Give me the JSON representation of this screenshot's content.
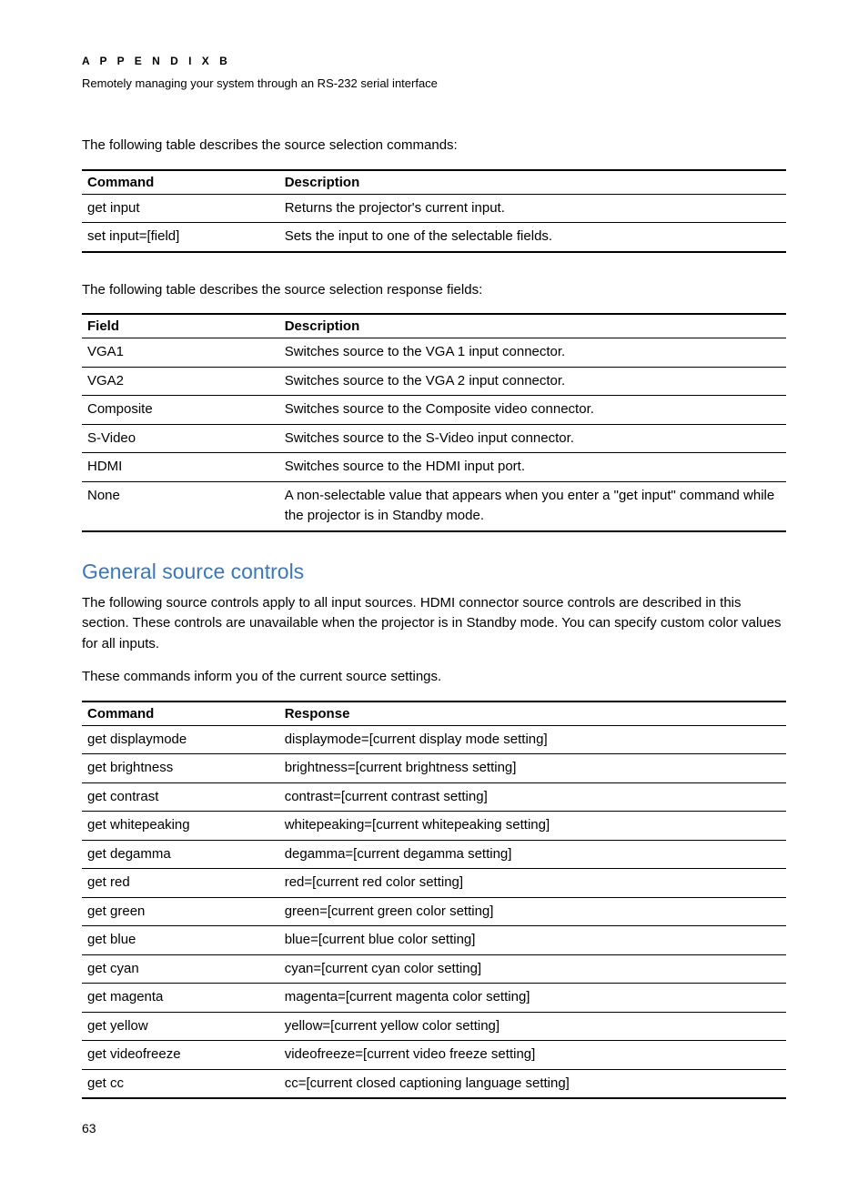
{
  "header": {
    "appendix": "A P P E N D I X   B",
    "subtitle": "Remotely managing your system through an RS-232 serial interface"
  },
  "intro1": "The following table describes the source selection commands:",
  "table1": {
    "headers": [
      "Command",
      "Description"
    ],
    "rows": [
      [
        "get input",
        "Returns the projector's current input."
      ],
      [
        "set input=[field]",
        "Sets the input to one of the selectable fields."
      ]
    ]
  },
  "intro2": "The following table describes the source selection response fields:",
  "table2": {
    "headers": [
      "Field",
      "Description"
    ],
    "rows": [
      [
        "VGA1",
        "Switches source to the VGA 1 input connector."
      ],
      [
        "VGA2",
        "Switches source to the VGA 2 input connector."
      ],
      [
        "Composite",
        "Switches source to the Composite video connector."
      ],
      [
        "S-Video",
        "Switches source to the S-Video input connector."
      ],
      [
        "HDMI",
        "Switches source to the HDMI input port."
      ],
      [
        "None",
        "A non-selectable value that appears when you enter a \"get input\" command while the projector is in Standby mode."
      ]
    ]
  },
  "section": {
    "heading": "General source controls",
    "para1": "The following source controls apply to all input sources. HDMI connector source controls are described in this section. These controls are unavailable when the projector is in Standby mode. You can specify custom color values for all inputs.",
    "para2": "These commands inform you of the current source settings."
  },
  "table3": {
    "headers": [
      "Command",
      "Response"
    ],
    "rows": [
      [
        "get displaymode",
        "displaymode=[current display mode setting]"
      ],
      [
        "get brightness",
        "brightness=[current brightness setting]"
      ],
      [
        "get contrast",
        "contrast=[current contrast setting]"
      ],
      [
        "get whitepeaking",
        "whitepeaking=[current whitepeaking setting]"
      ],
      [
        "get degamma",
        "degamma=[current degamma setting]"
      ],
      [
        "get red",
        "red=[current red color setting]"
      ],
      [
        "get green",
        "green=[current green color setting]"
      ],
      [
        "get blue",
        "blue=[current blue color setting]"
      ],
      [
        "get cyan",
        "cyan=[current cyan color setting]"
      ],
      [
        "get magenta",
        "magenta=[current magenta color setting]"
      ],
      [
        "get yellow",
        "yellow=[current yellow color setting]"
      ],
      [
        "get videofreeze",
        "videofreeze=[current video freeze setting]"
      ],
      [
        "get cc",
        "cc=[current closed captioning language setting]"
      ]
    ]
  },
  "pageNumber": "63"
}
